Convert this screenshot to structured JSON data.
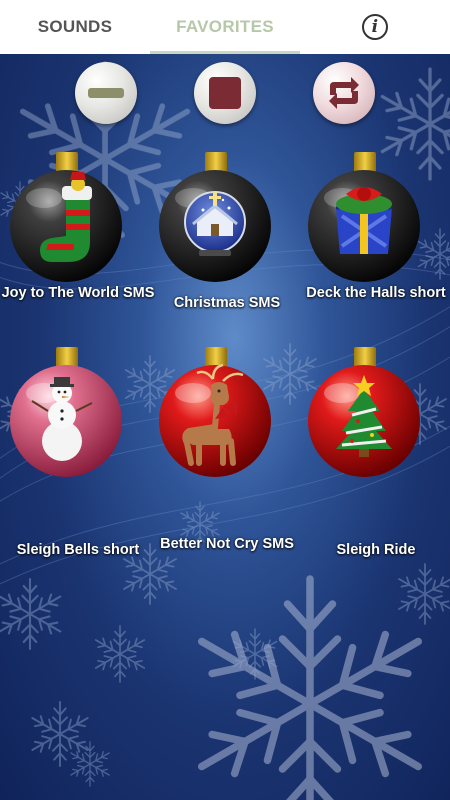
{
  "tabs": {
    "sounds_label": "SOUNDS",
    "favorites_label": "FAVORITES"
  },
  "controls": {
    "minus_icon": "minus-icon",
    "stop_icon": "stop-icon",
    "repeat_icon": "repeat-icon"
  },
  "ornaments": [
    {
      "label": "Joy to The World SMS",
      "ball_color": "#222222",
      "icon": "stocking-icon"
    },
    {
      "label": "Christmas SMS",
      "ball_color": "#222222",
      "icon": "snow-globe-church-icon"
    },
    {
      "label": "Deck the Halls short",
      "ball_color": "#222222",
      "icon": "gift-box-icon"
    },
    {
      "label": "Sleigh Bells short",
      "ball_color": "#c8506e",
      "icon": "snowman-icon"
    },
    {
      "label": "Better Not Cry SMS",
      "ball_color": "#c81414",
      "icon": "reindeer-icon"
    },
    {
      "label": "Sleigh Ride",
      "ball_color": "#c81414",
      "icon": "christmas-tree-icon"
    }
  ],
  "colors": {
    "tab_active": "#b6c8a8",
    "tab_inactive": "#555555",
    "background_blue": "#1b3572"
  }
}
